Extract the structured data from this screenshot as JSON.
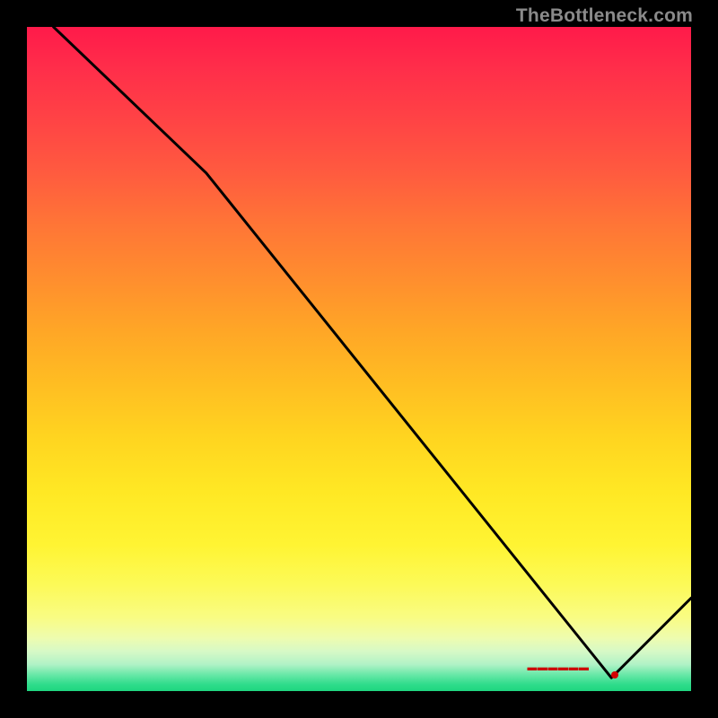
{
  "attribution": "TheBottleneck.com",
  "chart_data": {
    "type": "line",
    "title": "",
    "xlabel": "",
    "ylabel": "",
    "xlim": [
      0,
      100
    ],
    "ylim": [
      0,
      100
    ],
    "line": {
      "points": [
        {
          "x": 4,
          "y": 100
        },
        {
          "x": 27,
          "y": 78
        },
        {
          "x": 88,
          "y": 2
        },
        {
          "x": 100,
          "y": 14
        }
      ]
    },
    "annotation": {
      "label_visible": true,
      "label_x": 80,
      "label_y": 3.5,
      "marker_x": 88.5,
      "marker_y": 2.5
    },
    "colors": {
      "line": "#000000",
      "marker": "#d40000",
      "label": "#cc0000"
    }
  }
}
